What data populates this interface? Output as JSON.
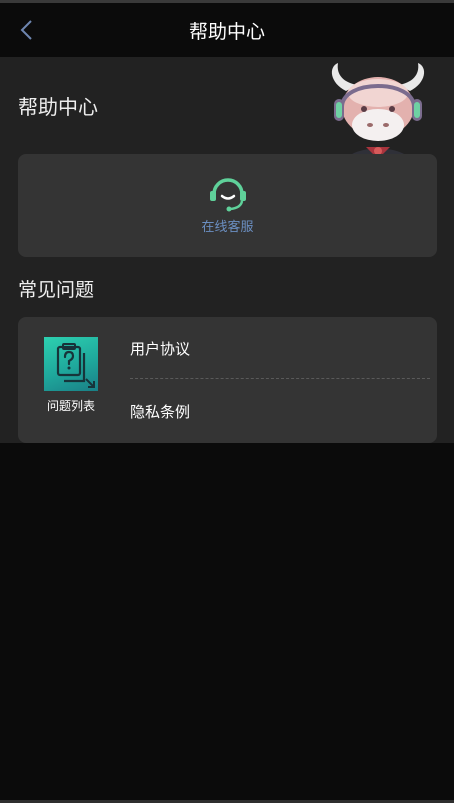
{
  "header": {
    "title": "帮助中心",
    "back_icon": "chevron-left-icon"
  },
  "page": {
    "heading": "帮助中心"
  },
  "service": {
    "label": "在线客服",
    "icon": "headset-icon",
    "icon_color": "#5fd19a"
  },
  "faq": {
    "heading": "常见问题",
    "category": {
      "label": "问题列表",
      "icon": "question-document-icon"
    },
    "items": [
      {
        "label": "用户协议"
      },
      {
        "label": "隐私条例"
      }
    ]
  },
  "colors": {
    "panel": "#222222",
    "card": "#343434",
    "background": "#0b0b0b",
    "service_label": "#6b8fc2"
  }
}
